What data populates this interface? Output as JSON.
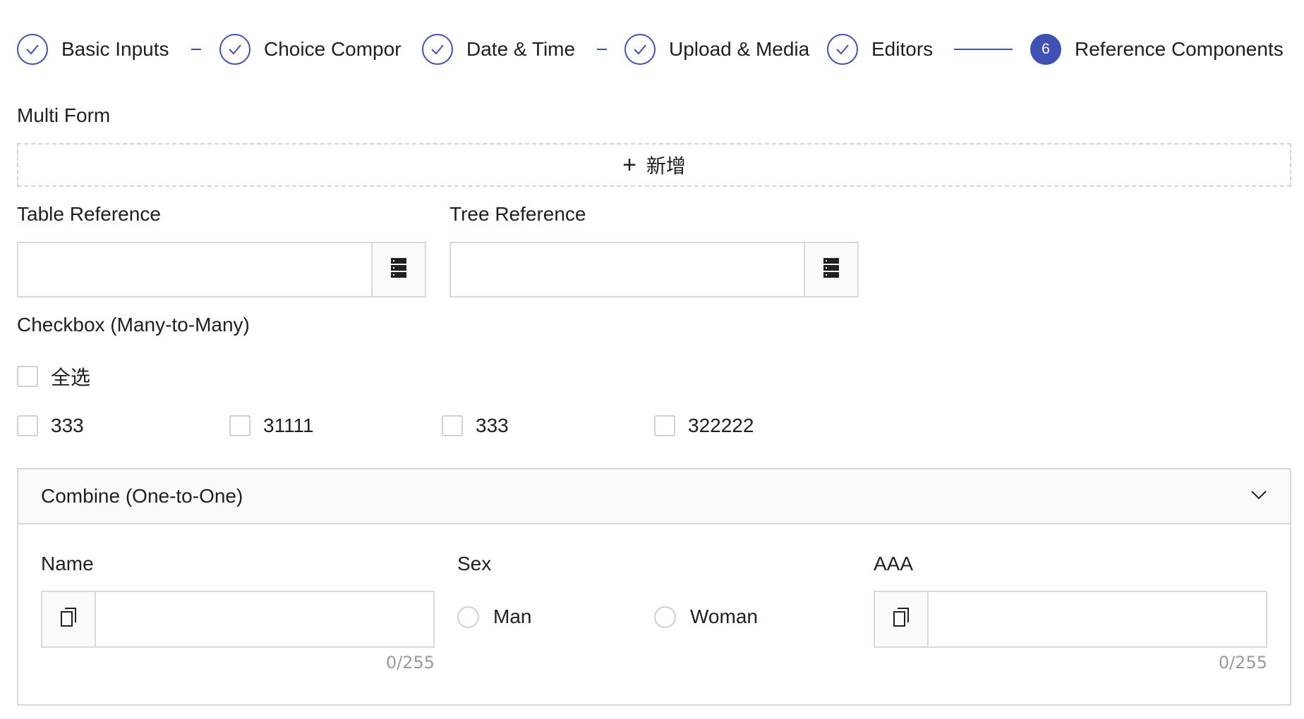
{
  "steps": [
    {
      "label": "Basic Inputs",
      "status": "done"
    },
    {
      "label": "Choice Compor",
      "status": "done"
    },
    {
      "label": "Date & Time",
      "status": "done"
    },
    {
      "label": "Upload & Media",
      "status": "done"
    },
    {
      "label": "Editors",
      "status": "done"
    },
    {
      "label": "Reference Components",
      "status": "active",
      "number": "6"
    }
  ],
  "multi_form": {
    "label": "Multi Form",
    "add_label": "新增"
  },
  "table_reference": {
    "label": "Table Reference",
    "value": ""
  },
  "tree_reference": {
    "label": "Tree Reference",
    "value": ""
  },
  "checkbox_group": {
    "label": "Checkbox (Many-to-Many)",
    "select_all_label": "全选",
    "options": [
      "333",
      "31111",
      "333",
      "322222"
    ]
  },
  "combine": {
    "title": "Combine (One-to-One)",
    "expanded": true,
    "name": {
      "label": "Name",
      "value": "",
      "counter": "0/255"
    },
    "sex": {
      "label": "Sex",
      "options": [
        "Man",
        "Woman"
      ]
    },
    "aaa": {
      "label": "AAA",
      "value": "",
      "counter": "0/255"
    }
  },
  "colors": {
    "accent": "#3f51b5",
    "border": "#d9d9d9",
    "addon_bg": "#fafafa"
  },
  "icons": {
    "step_done": "check-icon",
    "reference_addon": "list-icon",
    "input_prefix": "copy-icon",
    "panel_toggle": "chevron-down-icon",
    "add": "plus-icon"
  }
}
